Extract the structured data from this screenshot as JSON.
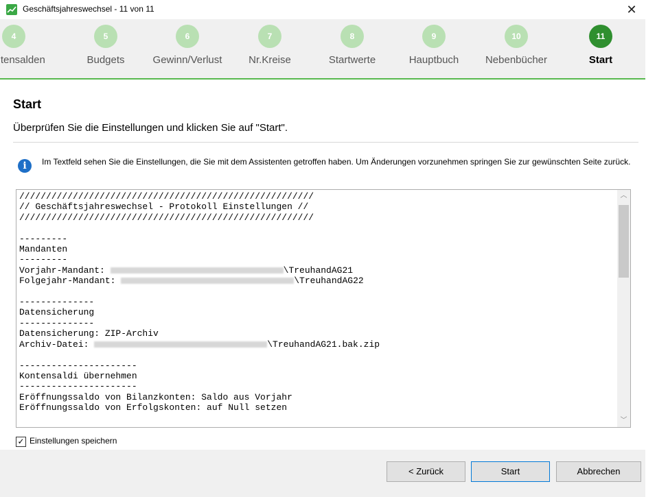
{
  "window": {
    "title": "Geschäftsjahreswechsel - 11 von 11",
    "close_symbol": "✕"
  },
  "steps": [
    {
      "num": "4",
      "label": "Kontensalden"
    },
    {
      "num": "5",
      "label": "Budgets"
    },
    {
      "num": "6",
      "label": "Gewinn/Verlust"
    },
    {
      "num": "7",
      "label": "Nr.Kreise"
    },
    {
      "num": "8",
      "label": "Startwerte"
    },
    {
      "num": "9",
      "label": "Hauptbuch"
    },
    {
      "num": "10",
      "label": "Nebenbücher"
    },
    {
      "num": "11",
      "label": "Start",
      "active": true
    }
  ],
  "main": {
    "heading": "Start",
    "subtitle": "Überprüfen Sie die Einstellungen und klicken Sie auf \"Start\".",
    "info": "Im Textfeld sehen Sie die Einstellungen, die Sie mit dem Assistenten getroffen haben. Um Änderungen vorzunehmen springen Sie zur gewünschten Seite zurück."
  },
  "protocol": {
    "line1": "///////////////////////////////////////////////////////",
    "line2": "// Geschäftsjahreswechsel - Protokoll Einstellungen //",
    "line3": "///////////////////////////////////////////////////////",
    "sep_short": "---------",
    "mandanten": "Mandanten",
    "vorjahr_label": "Vorjahr-Mandant:",
    "vorjahr_value": "\\TreuhandAG21",
    "folgejahr_label": "Folgejahr-Mandant:",
    "folgejahr_value": "\\TreuhandAG22",
    "sep_mid": "--------------",
    "datensicherung": "Datensicherung",
    "datensicherung_value": "Datensicherung: ZIP-Archiv",
    "archiv_label": "Archiv-Datei:",
    "archiv_value": "\\TreuhandAG21.bak.zip",
    "sep_long": "----------------------",
    "kontensaldi": "Kontensaldi übernehmen",
    "eroeffnung_bilanz": "Eröffnungssaldo von Bilanzkonten: Saldo aus Vorjahr",
    "eroeffnung_erfolg": "Eröffnungssaldo von Erfolgskonten: auf Null setzen"
  },
  "options": {
    "save_settings_label": "Einstellungen speichern",
    "save_settings_checked": true
  },
  "buttons": {
    "back": "< Zurück",
    "start": "Start",
    "cancel": "Abbrechen"
  },
  "colors": {
    "accent": "#57b84d",
    "active_step": "#2f8f2f",
    "inactive_step": "#b9e0b3",
    "info": "#1e6fc7"
  }
}
